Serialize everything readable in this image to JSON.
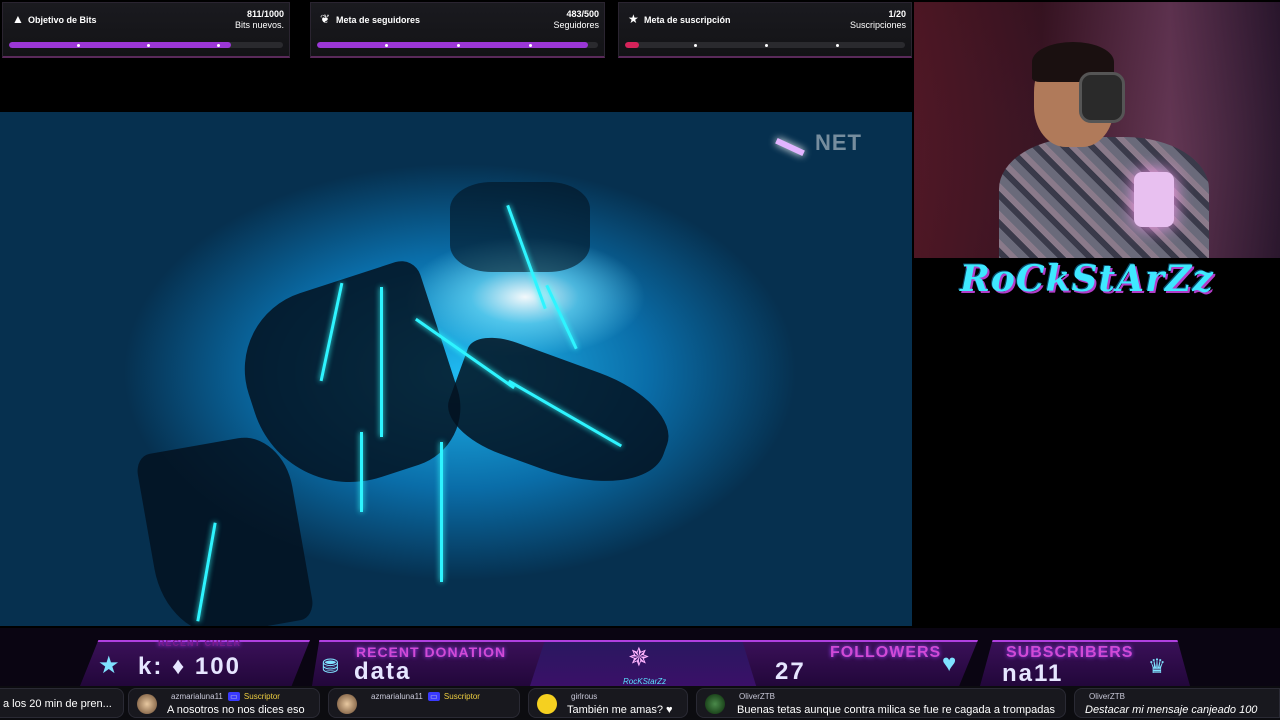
{
  "goals": [
    {
      "name": "Objetivo de Bits",
      "count": "811/1000",
      "sub": "Bits nuevos.",
      "progress": 0.811,
      "icon": "bits-icon",
      "color": "#9b37d6"
    },
    {
      "name": "Meta de seguidores",
      "count": "483/500",
      "sub": "Seguidores",
      "progress": 0.966,
      "icon": "heart-hands-icon",
      "color": "#9b37d6"
    },
    {
      "name": "Meta de suscripción",
      "count": "1/20",
      "sub": "Suscripciones",
      "progress": 0.05,
      "icon": "star-icon",
      "color": "#d6235a"
    }
  ],
  "video": {
    "watermark": "NET"
  },
  "brand": {
    "name": "RoCkStArZz"
  },
  "bottom_bar": {
    "recent_cheer": {
      "title": "RECENT CHEER",
      "value": "k: ♦ 100"
    },
    "recent_donation": {
      "title": "RECENT DONATION",
      "value": "data"
    },
    "center_logo": {
      "text": "RocKStarZz"
    },
    "followers": {
      "title": "FOLLOWERS",
      "value": "27"
    },
    "subscribers": {
      "title": "SUBSCRIBERS",
      "value": "na11"
    }
  },
  "chat": [
    {
      "user": "",
      "badge": "",
      "text": "a los 20 min de pren..."
    },
    {
      "user": "azmarialuna11",
      "badge": "Suscriptor",
      "text": "A nosotros no nos dices eso"
    },
    {
      "user": "azmarialuna11",
      "badge": "Suscriptor",
      "text": ""
    },
    {
      "user": "girlrous",
      "badge": "",
      "text": "También me amas? ♥"
    },
    {
      "user": "OliverZTB",
      "badge": "",
      "text": "Buenas tetas aunque contra milica se fue re cagada a trompadas"
    },
    {
      "user": "OliverZTB",
      "badge": "",
      "text": "Destacar mi mensaje canjeado 100"
    }
  ]
}
